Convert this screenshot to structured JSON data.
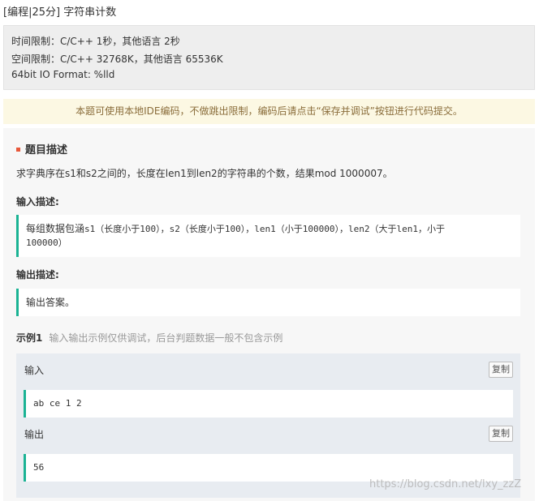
{
  "header": {
    "title": "[编程|25分] 字符串计数"
  },
  "limits": {
    "time": "时间限制：C/C++ 1秒，其他语言 2秒",
    "space": "空间限制：C/C++ 32768K，其他语言 65536K",
    "io_format": "64bit IO Format: %lld"
  },
  "notice": "本题可使用本地IDE编码，不做跳出限制，编码后请点击“保存并调试”按钮进行代码提交。",
  "problem": {
    "heading": "题目描述",
    "description": "求字典序在s1和s2之间的，长度在len1到len2的字符串的个数，结果mod 1000007。",
    "input_heading": "输入描述:",
    "input_line1_prefix": "每组数据包涵",
    "input_line1_mono": "s1（长度小于100），s2（长度小于100），len1（小于100000），len2（大于len1，小于",
    "input_line2_mono": "100000）",
    "output_heading": "输出描述:",
    "output_text": "输出答案。"
  },
  "example": {
    "title": "示例1",
    "hint": "输入输出示例仅供调试，后台判题数据一般不包含示例",
    "input_label": "输入",
    "input_value": "ab ce 1 2",
    "output_label": "输出",
    "output_value": "56",
    "copy_label": "复制"
  },
  "watermark": "https://blog.csdn.net/lxy_zzZ",
  "colors": {
    "accent": "#1ab394",
    "notice_text": "#8a6d3b",
    "heading_marker": "#e8573a"
  }
}
